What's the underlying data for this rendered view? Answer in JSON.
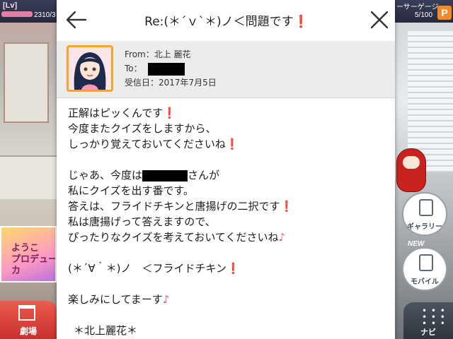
{
  "game": {
    "lv_label": "[Lv]",
    "lv_value": "2310/3",
    "gauge_label": "ーサーゲージ",
    "gauge_value": "5/100",
    "p_badge": "P",
    "promo_text": "ようこ\nプロデュー\nカ",
    "theater_label": "劇場",
    "gallery_label": "ギャラリー",
    "mobile_label": "モバイル",
    "new_tag": "NEW",
    "navi_label": "ナビ"
  },
  "mail": {
    "subject": "Re:(＊´ｖ`＊)ノ＜問題です",
    "subject_mark": "❗",
    "from": "From：北上 麗花",
    "to_label": "To：",
    "received": "受信日：2017年7月5日",
    "body": {
      "l1": "正解はピッくんです",
      "l2": "今度またクイズをしますから、",
      "l3": "しっかり覚えておいてくださいね",
      "l4a": "じゃあ、今度は",
      "l4b": "さんが",
      "l5": "私にクイズを出す番です。",
      "l6": "答えは、フライドチキンと唐揚げの二択です",
      "l7": "私は唐揚げって答えますので、",
      "l8": "ぴったりなクイズを考えておいてくださいね",
      "l9": "(＊´∀｀＊)ノ　＜フライドチキン",
      "l10": "楽しみにしてまーす",
      "l11": "＊北上麗花＊",
      "excl": "❗",
      "note": "♪"
    }
  }
}
